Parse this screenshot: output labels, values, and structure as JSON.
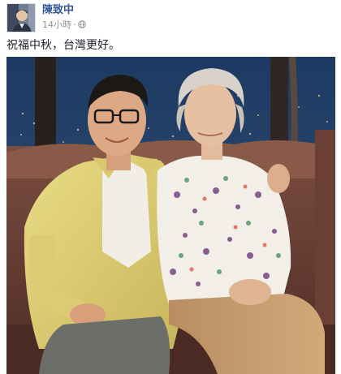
{
  "post": {
    "author_name": "陳致中",
    "timestamp": "14小時",
    "separator": "·",
    "privacy_icon": "globe-icon",
    "message": "祝福中秋，台灣更好。",
    "photo_icon": "post-photo"
  },
  "colors": {
    "author_link": "#365899",
    "meta_gray": "#90949c",
    "text": "#1d2129"
  }
}
